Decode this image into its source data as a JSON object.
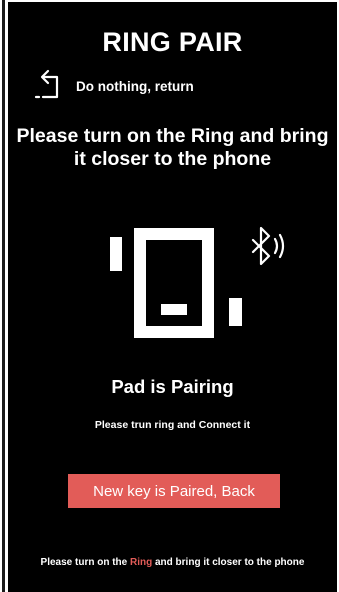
{
  "header": {
    "title": "RING PAIR"
  },
  "back": {
    "label": "Do nothing, return",
    "icon": "return-arrow-icon"
  },
  "instruction": {
    "text": "Please turn on the Ring and bring it closer to the phone"
  },
  "illustration": {
    "device_icon": "pad-device-icon",
    "bluetooth_icon": "bluetooth-icon"
  },
  "status": {
    "title": "Pad is Pairing",
    "subtitle": "Please trun ring and Connect it"
  },
  "action": {
    "button_label": "New key is Paired, Back"
  },
  "footer": {
    "before": "Please turn on the ",
    "highlight": "Ring",
    "after": " and bring it closer to the phone"
  },
  "colors": {
    "background": "#000000",
    "text": "#ffffff",
    "accent": "#e25c58"
  }
}
